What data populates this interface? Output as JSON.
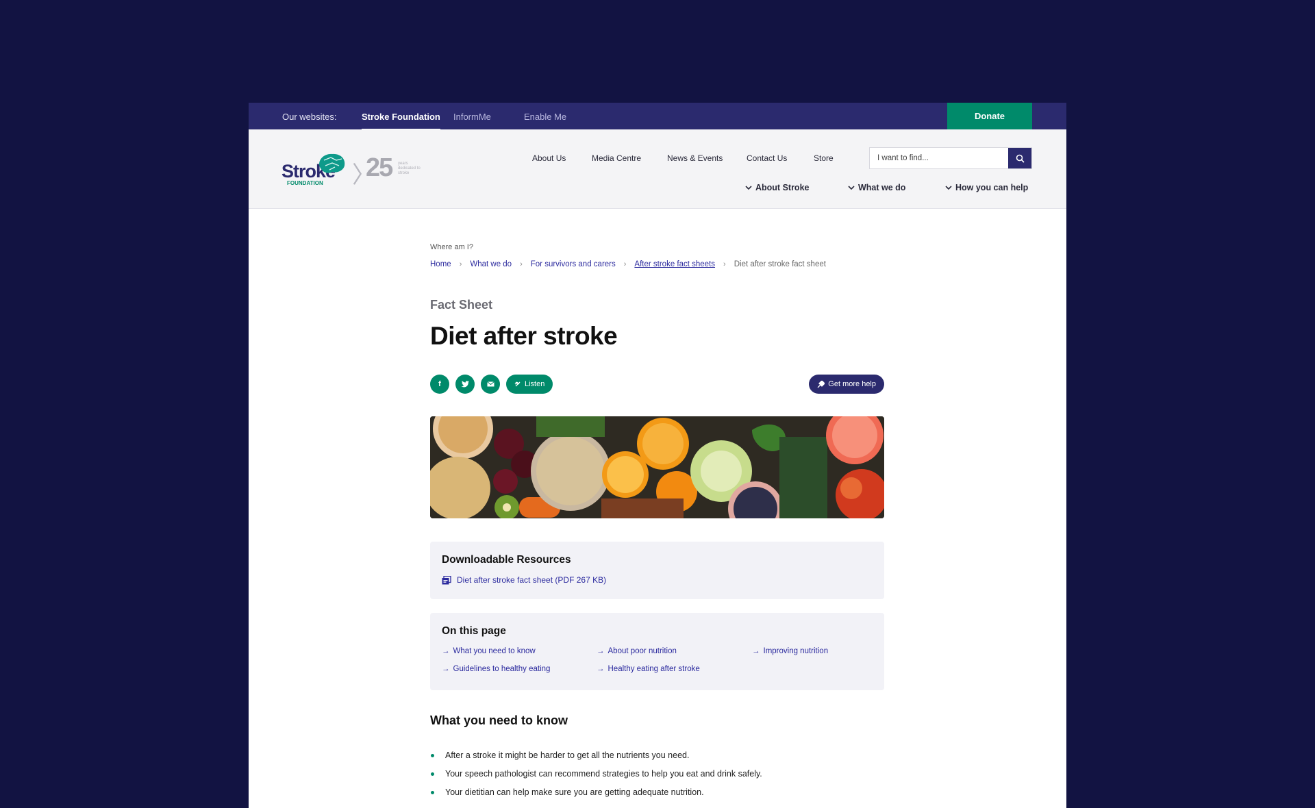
{
  "topbar": {
    "label": "Our websites:",
    "sites": [
      "Stroke Foundation",
      "InformMe",
      "Enable Me"
    ],
    "donate": "Donate"
  },
  "logo": {
    "wordmark": "Stroke",
    "sub": "FOUNDATION",
    "years": "25",
    "tagline": "years dedicated to stroke"
  },
  "nav": {
    "main": [
      "About Us",
      "Media Centre",
      "News & Events",
      "Contact Us",
      "Store"
    ],
    "search_placeholder": "I want to find...",
    "sub": [
      "About Stroke",
      "What we do",
      "How you can help"
    ]
  },
  "breadcrumb": {
    "label": "Where am I?",
    "items": [
      "Home",
      "What we do",
      "For survivors and carers",
      "After stroke fact sheets"
    ],
    "current": "Diet after stroke fact sheet"
  },
  "page": {
    "kicker": "Fact Sheet",
    "title": "Diet after stroke",
    "share": {
      "facebook": "f",
      "listen": "Listen"
    },
    "more_help": "Get more help"
  },
  "resources": {
    "heading": "Downloadable Resources",
    "link": "Diet after stroke fact sheet (PDF 267 KB)"
  },
  "on_this_page": {
    "heading": "On this page",
    "links": [
      "What you need to know",
      "About poor nutrition",
      "Improving nutrition",
      "Guidelines to healthy eating",
      "Healthy eating after stroke"
    ]
  },
  "section": {
    "heading": "What you need to know",
    "bullets": [
      "After a stroke it might be harder to get all the nutrients you need.",
      "Your speech pathologist can recommend strategies to help you eat and drink safely.",
      "Your dietitian can help make sure you are getting adequate nutrition."
    ]
  },
  "colors": {
    "navy": "#2b2a6e",
    "green": "#008a6a",
    "page_bg": "#121342",
    "link": "#2b2a9e"
  }
}
